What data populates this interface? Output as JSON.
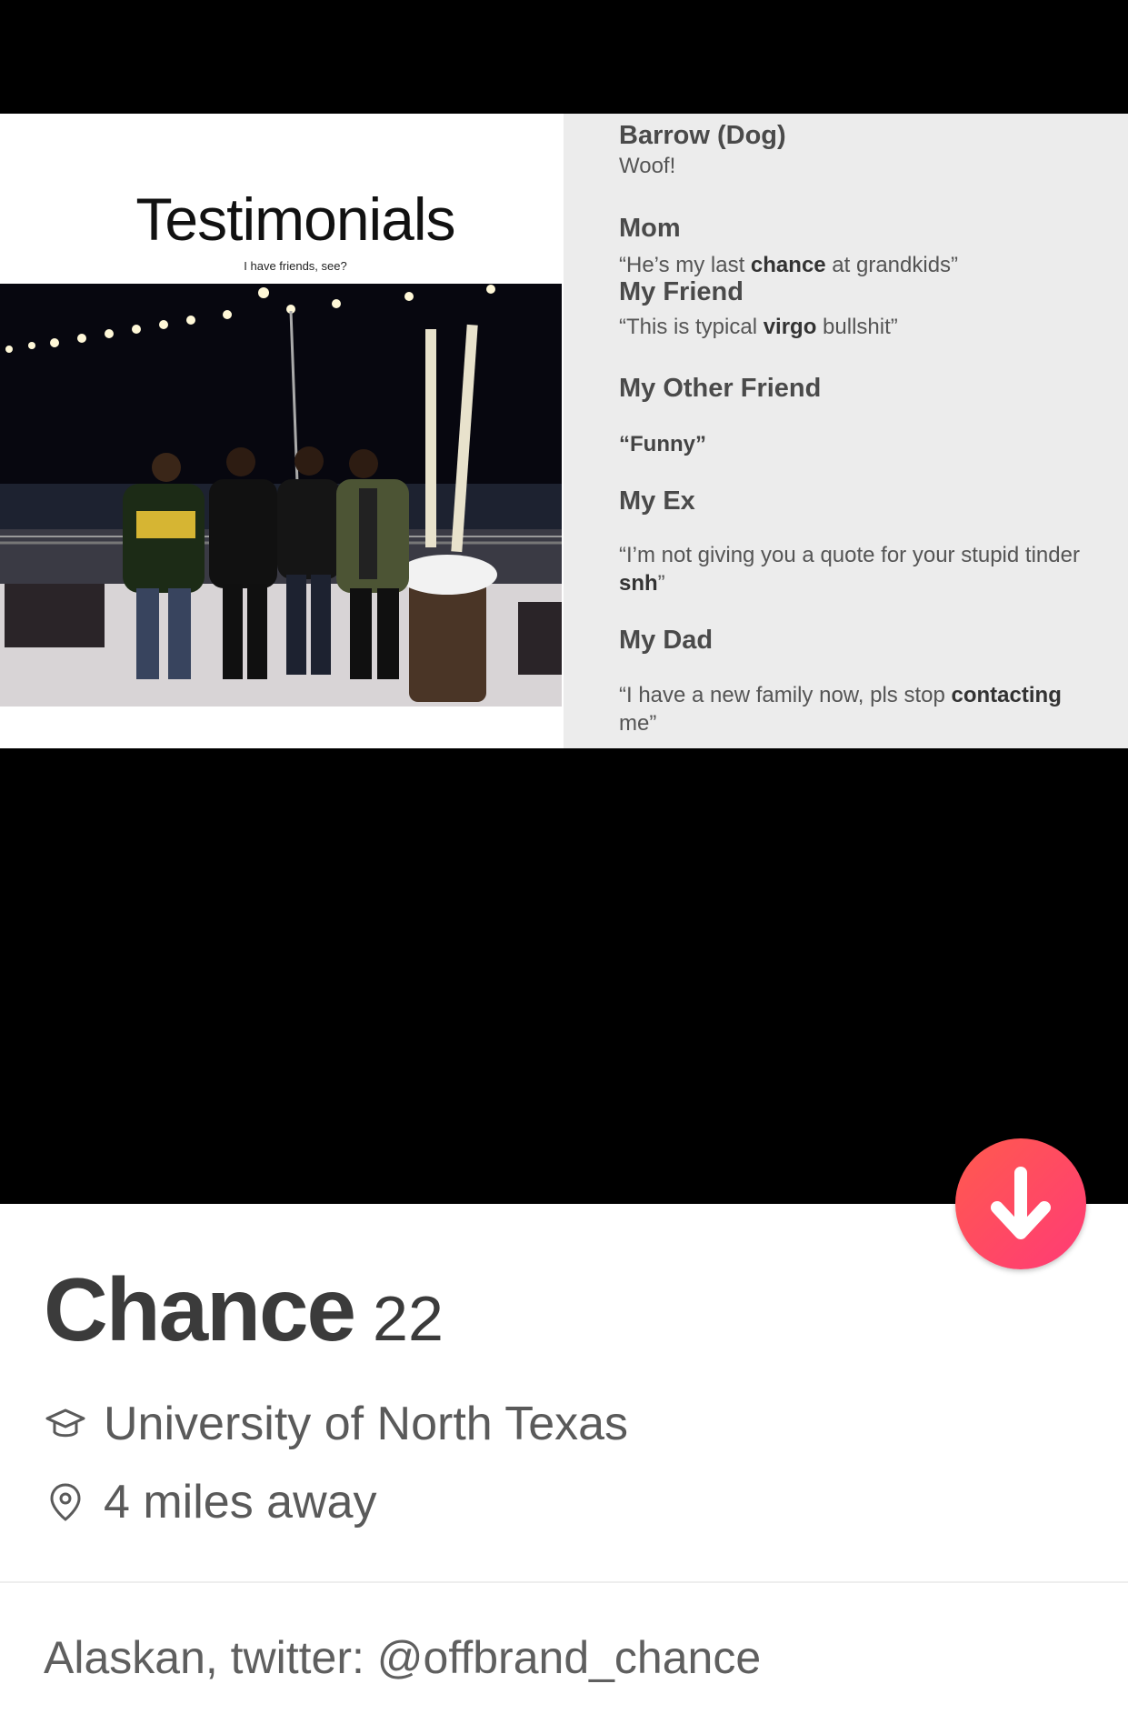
{
  "slide": {
    "title": "Testimonials",
    "subtitle": "I have friends, see?",
    "testimonials": [
      {
        "name": "Barrow (Dog)",
        "quote": "Woof!"
      },
      {
        "name": "Mom",
        "quote_pre": "“He’s my last ",
        "quote_bold": "chance",
        "quote_post": " at grandkids”"
      },
      {
        "name": "My Friend",
        "quote_pre": "“This is typical ",
        "quote_bold": "virgo",
        "quote_post": " bullshit”"
      },
      {
        "name": "My Other Friend",
        "quote": "“Funny”"
      },
      {
        "name": "My Ex",
        "quote_pre": "“I’m not giving you a quote for your stupid tinder ",
        "quote_bold": "snh",
        "quote_post": "”"
      },
      {
        "name": "My Dad",
        "quote_pre": "“I have a new family now, pls stop ",
        "quote_bold": "contacting",
        "quote_post": " me”"
      }
    ]
  },
  "profile": {
    "name": "Chance",
    "age": "22",
    "school": "University of North Texas",
    "distance": "4 miles away",
    "bio": "Alaskan, twitter: @offbrand_chance"
  },
  "icons": {
    "school": "graduation-cap-icon",
    "location": "location-pin-icon",
    "collapse": "arrow-down-icon"
  },
  "colors": {
    "accent_start": "#ff5a4e",
    "accent_end": "#ff3b76"
  }
}
